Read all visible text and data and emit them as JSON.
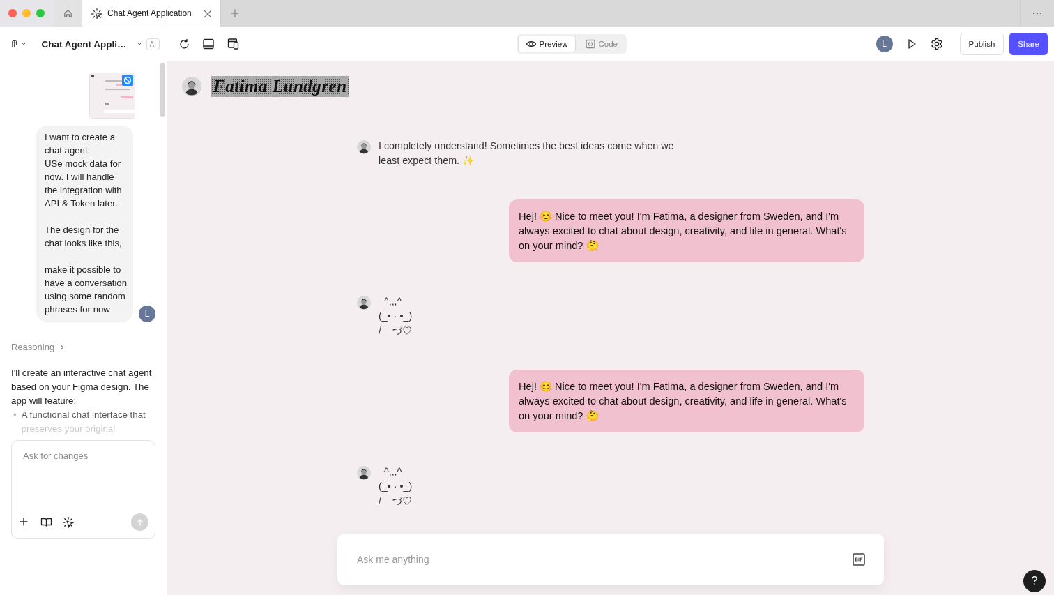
{
  "browser": {
    "tabs": [
      {
        "kind": "home",
        "selected": false
      },
      {
        "kind": "page",
        "label": "Chat Agent Application",
        "selected": true
      }
    ]
  },
  "toolbar": {
    "project_name": "Chat Agent Appli…",
    "ai_badge": "AI",
    "view_tabs": [
      {
        "kind": "preview",
        "label": "Preview",
        "selected": true
      },
      {
        "kind": "code",
        "label": "Code",
        "selected": false
      }
    ],
    "avatar": "L",
    "publish": "Publish",
    "share": "Share"
  },
  "sidebar": {
    "user_message": {
      "text": "I want to create a chat agent,\nUSe mock data for now. I will handle the integration with API & Token later..\n\nThe design for the chat looks like this,\n\nmake it possible to have a conversation using some random phrases for now",
      "avatar": "L"
    },
    "reasoning": "Reasoning",
    "response": {
      "intro": "I'll create an interactive chat agent based on your Figma design. The app will feature:",
      "bullets": [
        {
          "marker": "•",
          "text": "A functional chat interface that preserves your original"
        }
      ]
    },
    "input": {
      "placeholder": "Ask for changes"
    }
  },
  "preview": {
    "header_name": "Fatima Lundgren",
    "messages": [
      {
        "kind": "agent",
        "text": "I completely understand! Sometimes the best ideas come when we least expect them. ✨"
      },
      {
        "kind": "user",
        "text": "Hej! 😊 Nice to meet you! I'm Fatima, a designer from Sweden, and I'm always excited to chat about design, creativity, and life in general. What's on your mind? 🤔"
      },
      {
        "kind": "agent",
        "text": "  ^,,,^\n(_• · •_)\n/    づ♡"
      },
      {
        "kind": "user",
        "text": "Hej! 😊 Nice to meet you! I'm Fatima, a designer from Sweden, and I'm always excited to chat about design, creativity, and life in general. What's on your mind? 🤔"
      },
      {
        "kind": "agent",
        "text": "  ^,,,^\n(_• · •_)\n/    づ♡"
      }
    ],
    "input": {
      "placeholder": "Ask me anything"
    },
    "help": "?"
  }
}
